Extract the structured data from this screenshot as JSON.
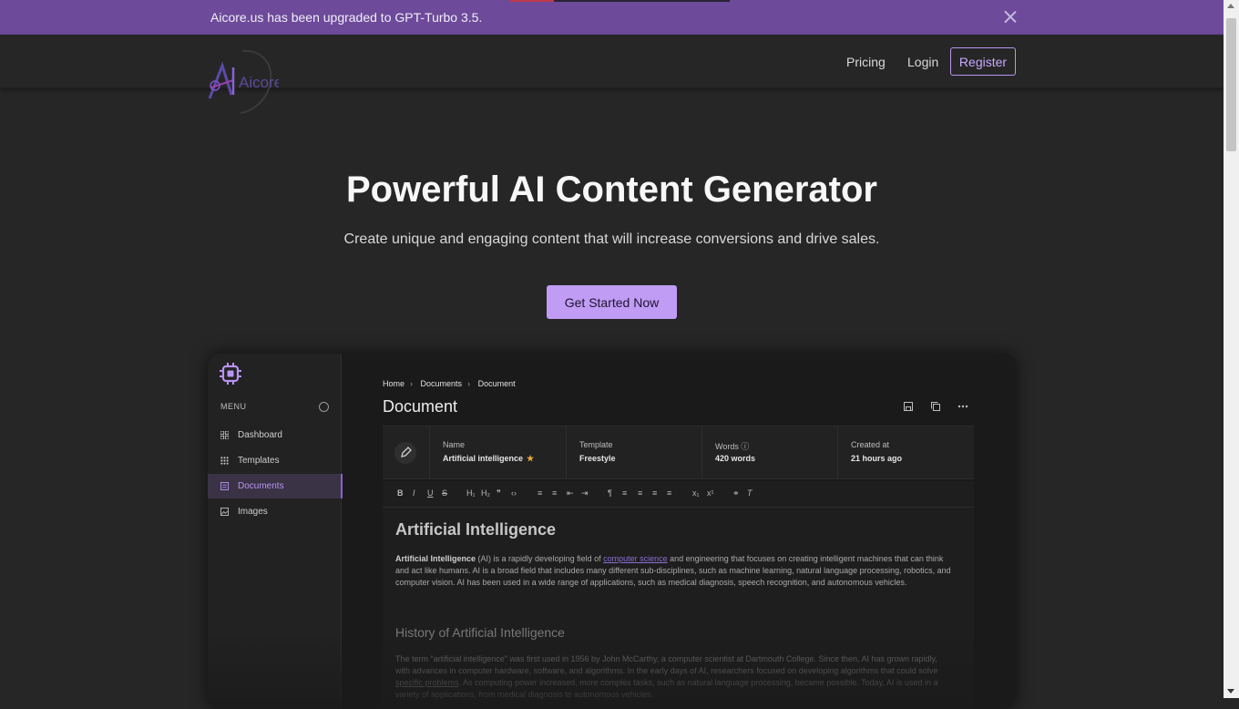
{
  "banner": {
    "text": "Aicore.us has been upgraded to GPT-Turbo 3.5.",
    "close_icon": "close-icon"
  },
  "header": {
    "logo_text": "Aicore",
    "nav": {
      "pricing": "Pricing",
      "login": "Login",
      "register": "Register"
    }
  },
  "hero": {
    "title": "Powerful AI Content Generator",
    "subtitle": "Create unique and engaging content that will increase conversions and drive sales.",
    "cta": "Get Started Now"
  },
  "preview": {
    "sidebar": {
      "menu_label": "MENU",
      "items": [
        {
          "label": "Dashboard",
          "icon": "dashboard-icon",
          "active": false
        },
        {
          "label": "Templates",
          "icon": "grid-icon",
          "active": false
        },
        {
          "label": "Documents",
          "icon": "document-icon",
          "active": true
        },
        {
          "label": "Images",
          "icon": "image-icon",
          "active": false
        }
      ]
    },
    "breadcrumb": [
      "Home",
      "Documents",
      "Document"
    ],
    "doc_title": "Document",
    "meta": {
      "name_label": "Name",
      "name_value": "Artificial intelligence",
      "template_label": "Template",
      "template_value": "Freestyle",
      "words_label": "Words",
      "words_value": "420 words",
      "created_label": "Created at",
      "created_value": "21 hours ago"
    },
    "article": {
      "h1": "Artificial Intelligence",
      "p1_bold": "Artificial Intelligence",
      "p1_a": " (AI) is a rapidly developing field of ",
      "p1_link": "computer science",
      "p1_b": " and engineering that focuses on creating intelligent machines that can think and act like humans. AI is a broad field that includes many different sub-disciplines, such as machine learning, natural language processing, robotics, and computer vision. AI has been used in a wide range of applications, such as medical diagnosis, speech recognition, and autonomous vehicles.",
      "h2": "History of Artificial Intelligence",
      "p2_a": "The term \"artificial intelligence\" was first used in 1956 by John McCarthy, a computer scientist at Dartmouth College. Since then, AI has grown rapidly, with advances in computer hardware, software, and algorithms. In the early days of AI, researchers focused on developing algorithms that could solve ",
      "p2_link": "specific problems",
      "p2_b": ". As computing power increased, more complex tasks, such as natural language processing, became possible. Today, AI is used in a variety of applications, from medical diagnosis to autonomous vehicles."
    }
  },
  "colors": {
    "accent": "#c09cf4",
    "banner_bg": "#6d4a9a",
    "page_bg": "#262626"
  }
}
